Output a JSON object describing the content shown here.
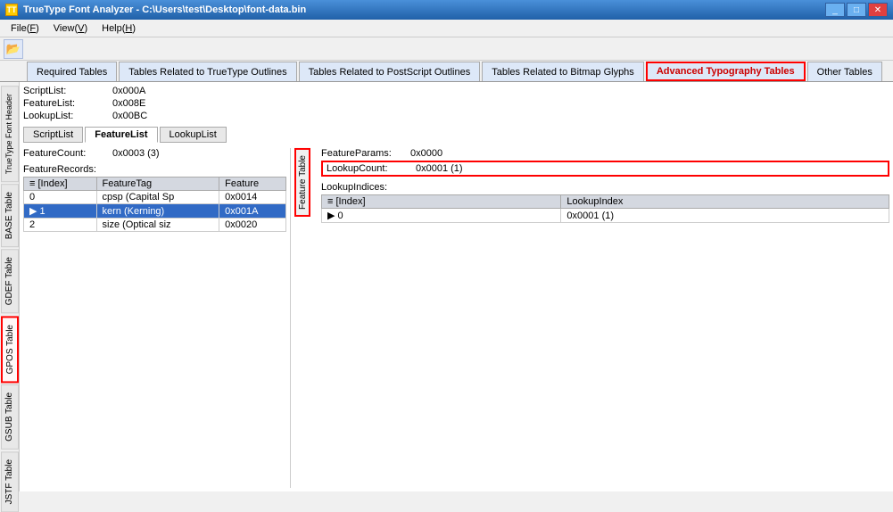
{
  "window": {
    "title": "TrueType Font Analyzer - C:\\Users\\test\\Desktop\\font-data.bin",
    "icon": "TT"
  },
  "menu": {
    "items": [
      {
        "label": "File(F)",
        "key": "file"
      },
      {
        "label": "View(V)",
        "key": "view"
      },
      {
        "label": "Help(H)",
        "key": "help"
      }
    ]
  },
  "tabs": [
    {
      "label": "Required Tables",
      "key": "required"
    },
    {
      "label": "Tables Related to TrueType Outlines",
      "key": "truetype"
    },
    {
      "label": "Tables Related to PostScript Outlines",
      "key": "postscript"
    },
    {
      "label": "Tables Related to Bitmap Glyphs",
      "key": "bitmap"
    },
    {
      "label": "Advanced Typography Tables",
      "key": "advanced",
      "active": true,
      "highlighted": true
    },
    {
      "label": "Other Tables",
      "key": "other"
    }
  ],
  "vertical_tabs": [
    {
      "label": "TrueType Font Header",
      "key": "base",
      "active": false
    },
    {
      "label": "BASE Table",
      "key": "base_tbl",
      "active": false
    },
    {
      "label": "GDEF Table",
      "key": "gdef",
      "active": false
    },
    {
      "label": "GPOS Table",
      "key": "gpos",
      "active": true,
      "highlighted": true
    },
    {
      "label": "GSUB Table",
      "key": "gsub",
      "active": false
    },
    {
      "label": "JSTF Table",
      "key": "jstf",
      "active": false
    }
  ],
  "sub_tabs": [
    {
      "label": "ScriptList",
      "key": "scriptlist"
    },
    {
      "label": "FeatureList",
      "key": "featurelist",
      "active": true
    },
    {
      "label": "LookupList",
      "key": "lookuplist"
    }
  ],
  "feature_table_tab_label": "Feature Table",
  "feature_list": {
    "feature_count_label": "FeatureCount:",
    "feature_count_value": "0x0003 (3)",
    "feature_records_label": "FeatureRecords:",
    "table_headers": [
      "[Index]",
      "FeatureTag",
      "Feature"
    ],
    "rows": [
      {
        "index": "0",
        "tag": "cpsp (Capital Sp",
        "feature": "0x0014",
        "selected": false
      },
      {
        "index": "1",
        "tag": "kern (Kerning)",
        "feature": "0x001A",
        "selected": true
      },
      {
        "index": "2",
        "tag": "size (Optical siz",
        "feature": "0x0020",
        "selected": false
      }
    ]
  },
  "feature_detail": {
    "feature_params_label": "FeatureParams:",
    "feature_params_value": "0x0000",
    "lookup_count_label": "LookupCount:",
    "lookup_count_value": "0x0001 (1)",
    "lookup_indices_label": "LookupIndices:",
    "table_headers": [
      "[Index]",
      "LookupIndex"
    ],
    "rows": [
      {
        "index": "0",
        "lookup_index": "0x0001 (1)",
        "selected": true
      }
    ]
  },
  "script_list": {
    "script_list_label": "ScriptList:",
    "script_list_value": "0x000A",
    "feature_list_label": "FeatureList:",
    "feature_list_value": "0x008E",
    "lookup_list_label": "LookupList:",
    "lookup_list_value": "0x00BC"
  }
}
